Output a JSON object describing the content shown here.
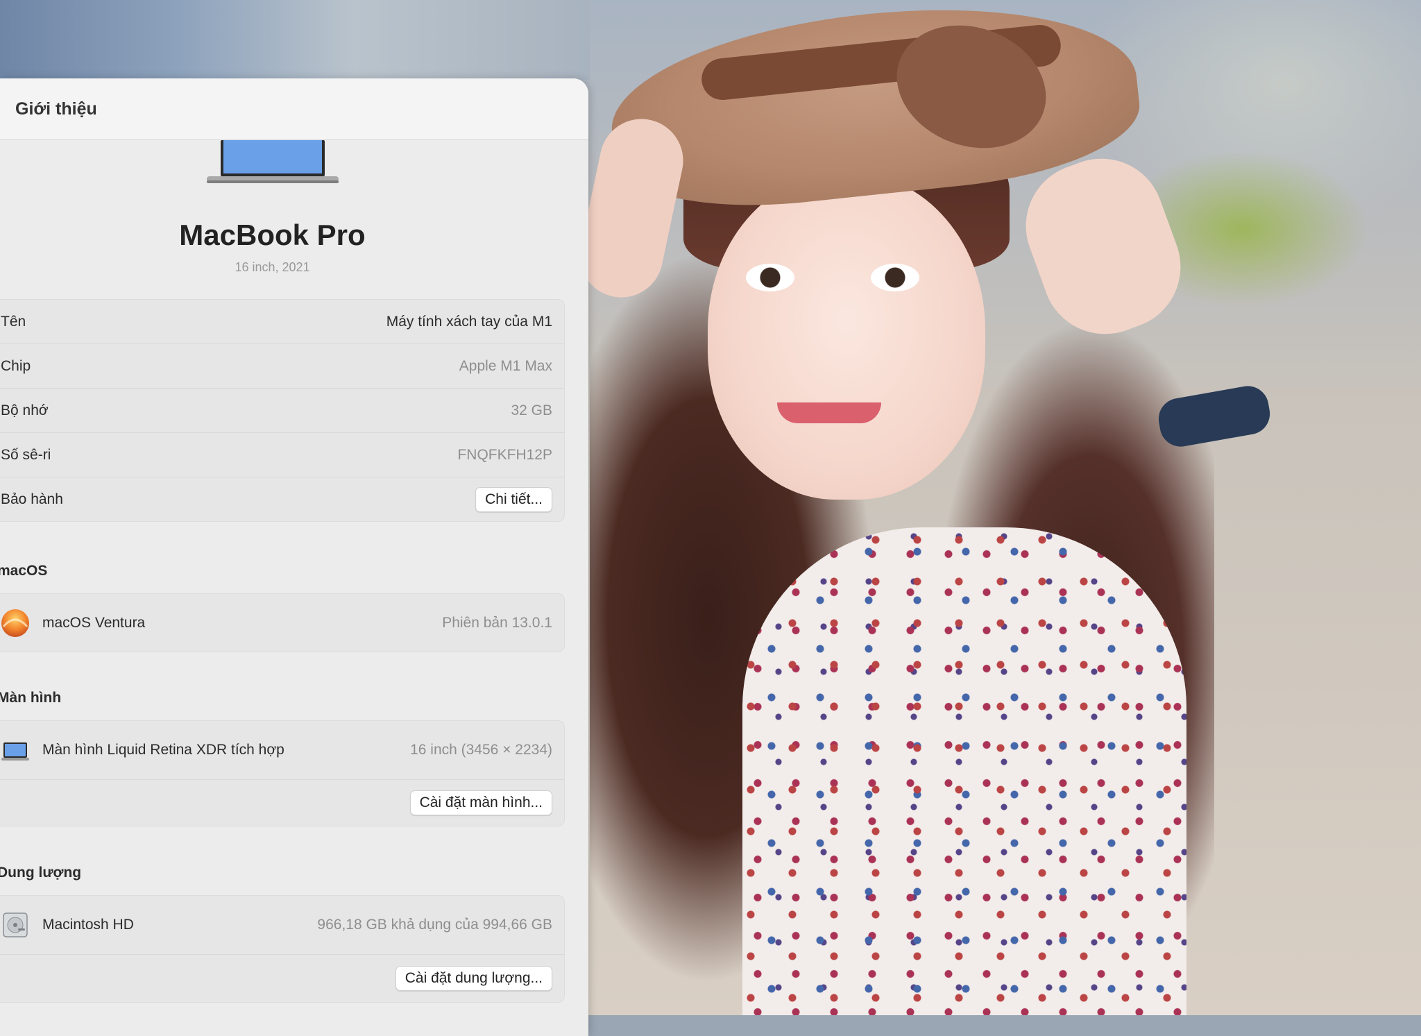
{
  "window": {
    "title": "Giới thiệu"
  },
  "device": {
    "name": "MacBook Pro",
    "subtitle": "16 inch, 2021"
  },
  "specs": [
    {
      "label": "Tên",
      "value": "Máy tính xách tay của M1"
    },
    {
      "label": "Chip",
      "value": "Apple M1 Max"
    },
    {
      "label": "Bộ nhớ",
      "value": "32 GB"
    },
    {
      "label": "Số sê-ri",
      "value": "FNQFKFH12P"
    },
    {
      "label": "Bảo hành",
      "button": "Chi tiết..."
    }
  ],
  "macos": {
    "heading": "macOS",
    "name": "macOS Ventura",
    "version": "Phiên bản 13.0.1"
  },
  "display": {
    "heading": "Màn hình",
    "name": "Màn hình Liquid Retina XDR tích hợp",
    "size": "16 inch (3456 × 2234)",
    "button": "Cài đặt màn hình..."
  },
  "storage": {
    "heading": "Dung lượng",
    "name": "Macintosh HD",
    "capacity": "966,18 GB khả dụng của 994,66 GB",
    "button": "Cài đặt dung lượng..."
  },
  "icons": {
    "laptop": "laptop-icon",
    "macos": "macos-ventura-icon",
    "display": "display-icon",
    "disk": "hard-disk-icon"
  },
  "colors": {
    "window_bg": "#ececec",
    "group_bg": "#e6e6e6",
    "screen_blue": "#6aa0e8"
  }
}
